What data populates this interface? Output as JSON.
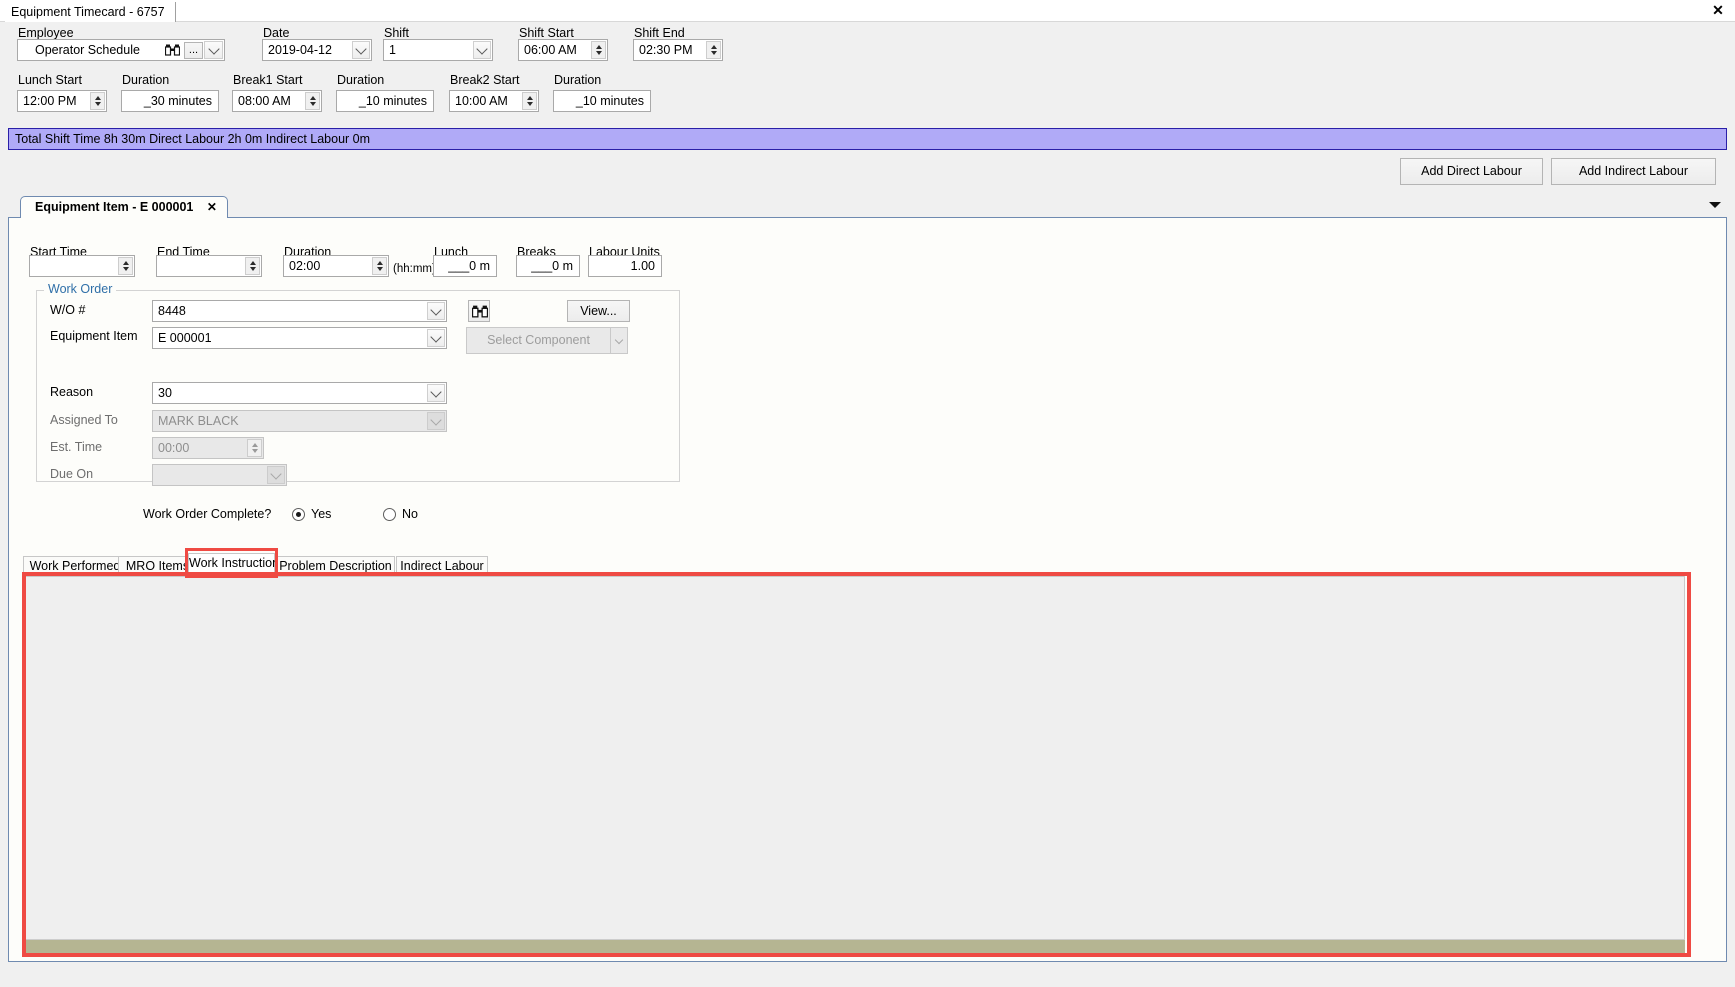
{
  "window": {
    "tab_title": "Equipment Timecard - 6757",
    "close_label": "✕"
  },
  "header": {
    "employee_label": "Employee",
    "employee_value": "Operator Schedule",
    "employee_ellipsis": "...",
    "date_label": "Date",
    "date_value": "2019-04-12",
    "shift_label": "Shift",
    "shift_value": "1",
    "shift_start_label": "Shift Start",
    "shift_start_value": "06:00 AM",
    "shift_end_label": "Shift End",
    "shift_end_value": "02:30 PM",
    "lunch_start_label": "Lunch Start",
    "lunch_start_value": "12:00 PM",
    "lunch_duration_label": "Duration",
    "lunch_duration_value": "_30 minutes",
    "break1_start_label": "Break1 Start",
    "break1_start_value": "08:00 AM",
    "break1_duration_label": "Duration",
    "break1_duration_value": "_10 minutes",
    "break2_start_label": "Break2 Start",
    "break2_start_value": "10:00 AM",
    "break2_duration_label": "Duration",
    "break2_duration_value": "_10 minutes"
  },
  "summary": {
    "text": "Total Shift Time 8h 30m  Direct Labour 2h 0m  Indirect Labour 0m",
    "background": "#b0aaf7",
    "border": "#2a1fa8"
  },
  "toolbar": {
    "add_direct_labour": "Add Direct Labour",
    "add_indirect_labour": "Add Indirect Labour"
  },
  "doc_tab": {
    "label": "Equipment Item - E 000001",
    "close": "✕"
  },
  "times": {
    "start_time_label": "Start Time",
    "start_time_value": "",
    "end_time_label": "End Time",
    "end_time_value": "",
    "duration_label": "Duration",
    "duration_value": "02:00",
    "duration_hint": "(hh:mm)",
    "lunch_label": "Lunch",
    "lunch_value": "___0 m",
    "breaks_label": "Breaks",
    "breaks_value": "___0 m",
    "labour_units_label": "Labour Units",
    "labour_units_value": "1.00"
  },
  "work_order": {
    "legend": "Work Order",
    "legend_color": "#2f6fa8",
    "wo_label": "W/O #",
    "wo_value": "8448",
    "search_icon": "binoculars-icon",
    "view_button": "View...",
    "equipment_item_label": "Equipment Item",
    "equipment_item_value": "E 000001",
    "select_component_button": "Select Component",
    "reason_label": "Reason",
    "reason_value": "30",
    "assigned_to_label": "Assigned To",
    "assigned_to_value": "MARK BLACK",
    "est_time_label": "Est. Time",
    "est_time_value": "00:00",
    "due_on_label": "Due On",
    "due_on_value": "",
    "complete_label": "Work Order Complete?",
    "yes_label": "Yes",
    "no_label": "No",
    "complete_selected": "Yes"
  },
  "bottom_tabs": {
    "items": [
      {
        "label": "Work Performed",
        "selected": false
      },
      {
        "label": "MRO Items",
        "selected": false
      },
      {
        "label": "Work Instructions",
        "selected": true
      },
      {
        "label": "Problem Description",
        "selected": false
      },
      {
        "label": "Indirect Labour",
        "selected": false
      }
    ],
    "highlight_color": "#ef4a43"
  }
}
